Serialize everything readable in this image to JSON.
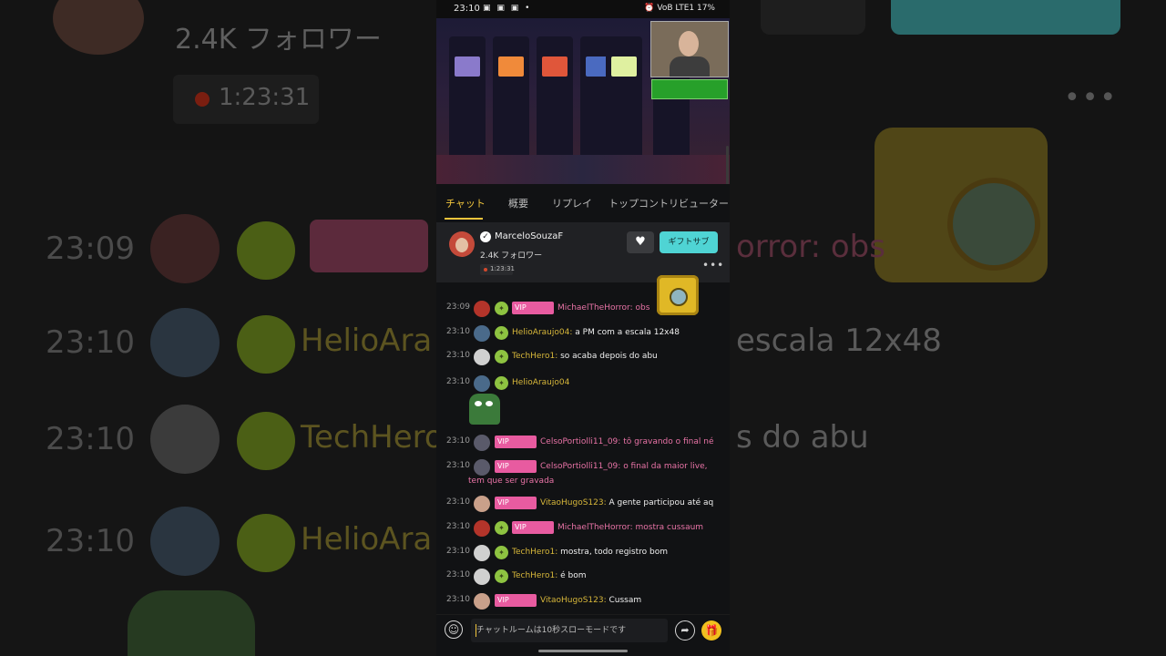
{
  "statusbar": {
    "time": "23:10",
    "battery": "17%",
    "network": "VoB LTE1"
  },
  "tabs": [
    {
      "label": "チャット"
    },
    {
      "label": "概要"
    },
    {
      "label": "リプレイ"
    },
    {
      "label": "トップコントリビューター"
    }
  ],
  "profile": {
    "name": "MarceloSouzaF",
    "followers": "2.4K フォロワー",
    "live_time": "1:23:31",
    "gift_label": "ギフトサブ"
  },
  "vip_label": "VIP",
  "chat": [
    {
      "time": "23:09",
      "user": "MichaelTheHorror",
      "sep": ": ",
      "text": "obs",
      "vip": true,
      "color": "pink"
    },
    {
      "time": "23:10",
      "user": "HelioAraujo04",
      "sep": ": ",
      "text": "a PM com a escala 12x48",
      "vip": false,
      "color": "yellow"
    },
    {
      "time": "23:10",
      "user": "TechHero1",
      "sep": ": ",
      "text": "so acaba depois do abu",
      "vip": false,
      "color": "yellow"
    },
    {
      "time": "23:10",
      "user": "HelioAraujo04",
      "sep": "",
      "text": "",
      "vip": false,
      "color": "yellow"
    },
    {
      "time": "23:10",
      "user": "CelsoPortiolli11_09",
      "sep": ": ",
      "text": "tô gravando o final né",
      "vip": true,
      "color": "pink"
    },
    {
      "time": "23:10",
      "user": "CelsoPortiolli11_09",
      "sep": ": ",
      "text": "o final da maior live,",
      "cont": "tem que ser gravada",
      "vip": true,
      "color": "pink"
    },
    {
      "time": "23:10",
      "user": "VitaoHugoS123",
      "sep": ": ",
      "text": "A gente participou até aq",
      "vip": true,
      "color": "yellow"
    },
    {
      "time": "23:10",
      "user": "MichaelTheHorror",
      "sep": ": ",
      "text": "mostra cussaum",
      "vip": true,
      "color": "pink"
    },
    {
      "time": "23:10",
      "user": "TechHero1",
      "sep": ": ",
      "text": "mostra, todo registro bom",
      "vip": false,
      "color": "yellow"
    },
    {
      "time": "23:10",
      "user": "TechHero1",
      "sep": ": ",
      "text": "é bom",
      "vip": false,
      "color": "yellow"
    },
    {
      "time": "23:10",
      "user": "VitaoHugoS123",
      "sep": ": ",
      "text": "Cussam",
      "vip": true,
      "color": "yellow"
    }
  ],
  "input": {
    "placeholder": "チャットルームは10秒スローモードです"
  },
  "icons": {
    "emoji": "smiley-icon",
    "share": "share-icon",
    "gift": "gift-icon",
    "heart": "heart-icon",
    "more": "more-icon",
    "verified": "verified-icon"
  },
  "colors": {
    "accent": "#f0c43c",
    "vip": "#e85ba0",
    "gift_button": "#4fd4d4",
    "name_yellow": "#d7b73a",
    "name_pink": "#e873a6"
  },
  "background": {
    "followers": "2.4K フォロワー",
    "live_time": "1:23:31",
    "rows": [
      {
        "time": "23:09",
        "name": "",
        "msg": "orror: obs"
      },
      {
        "time": "23:10",
        "name": "HelioAra",
        "msg": "escala 12x48"
      },
      {
        "time": "23:10",
        "name": "TechHero",
        "msg": "s do abu"
      },
      {
        "time": "23:10",
        "name": "HelioAra",
        "msg": ""
      }
    ]
  }
}
